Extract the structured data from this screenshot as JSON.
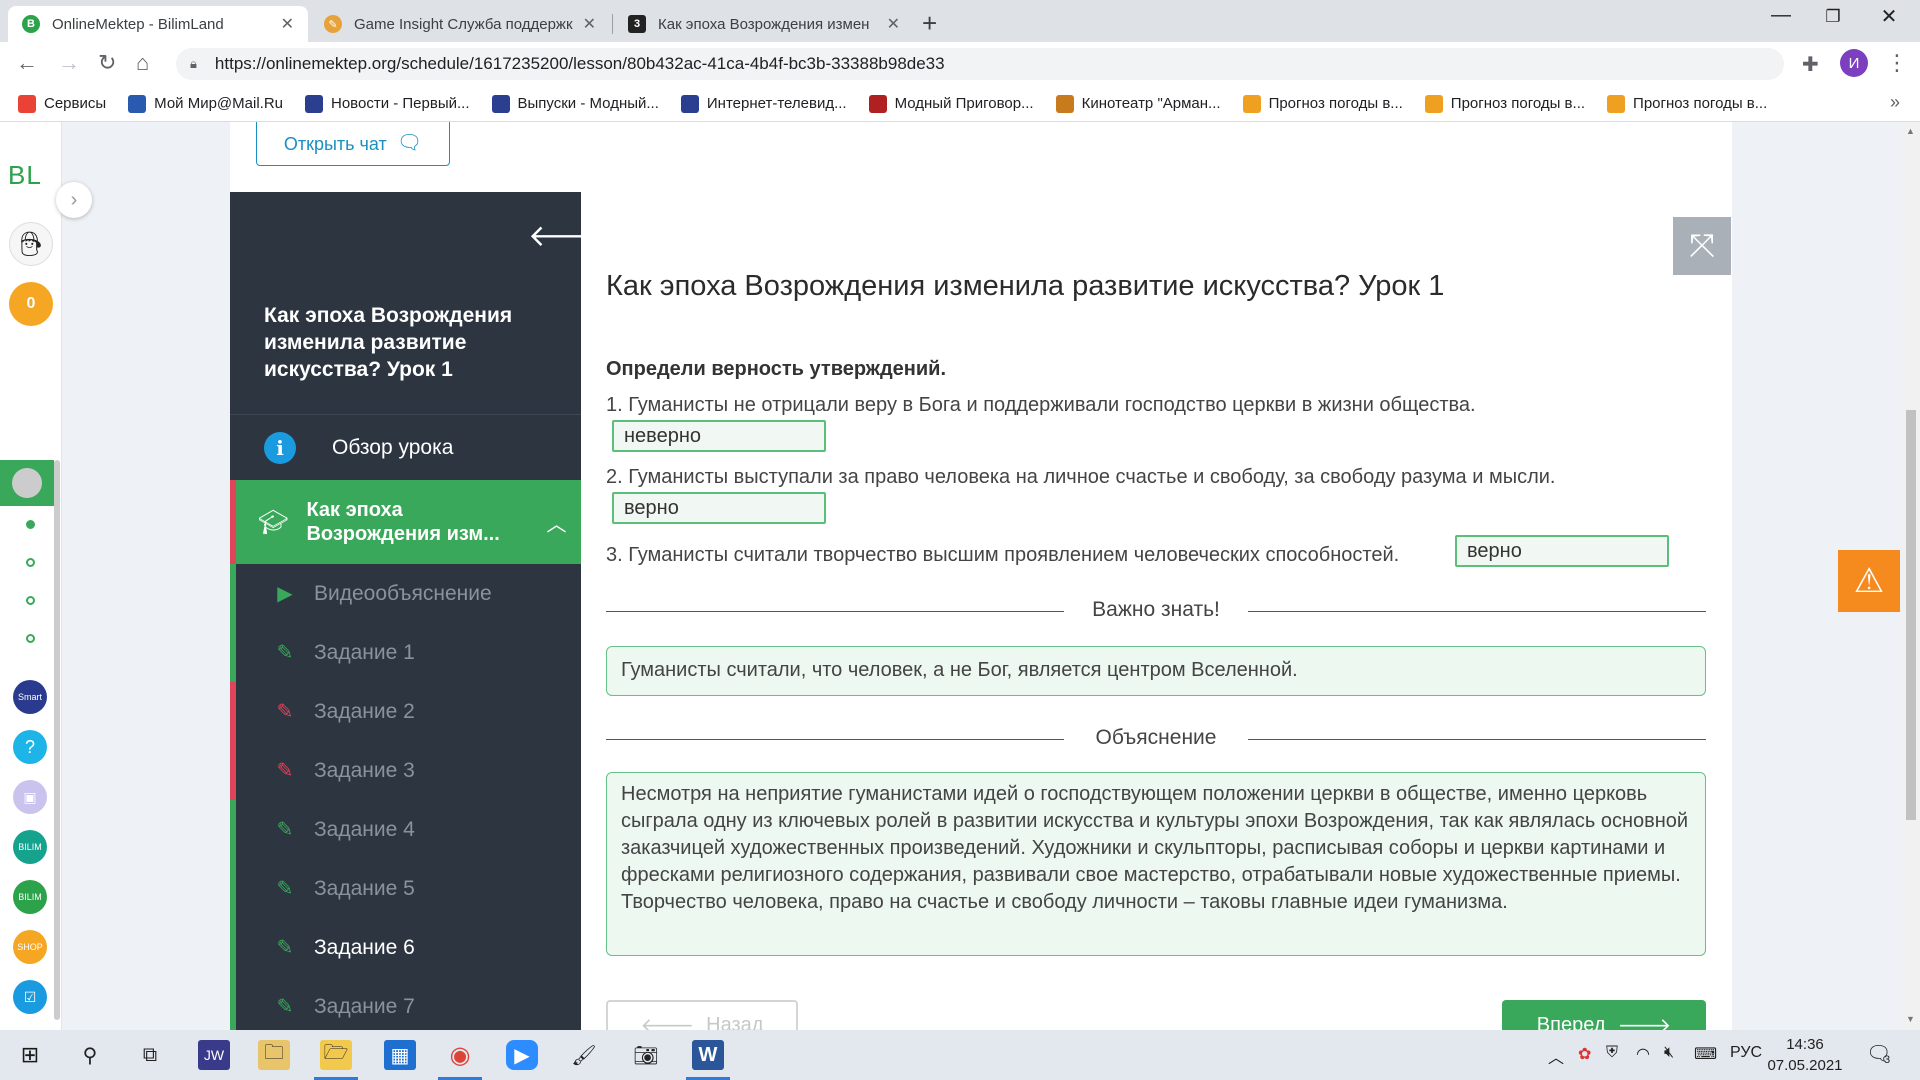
{
  "browser": {
    "tabs": [
      {
        "title": "OnlineMektep - BilimLand",
        "favicon": "B",
        "favicon_color": "#2ca24a",
        "close": "✕"
      },
      {
        "title": "Game Insight Служба поддержк",
        "favicon": "✎",
        "favicon_color": "#e8a23a",
        "close": "✕"
      },
      {
        "title": "Как эпоха Возрождения измен",
        "favicon": "3",
        "favicon_color": "#222222",
        "close": "✕"
      }
    ],
    "new_tab": "+",
    "url": "https://onlinemektep.org/schedule/1617235200/lesson/80b432ac-41ca-4b4f-bc3b-33388b98de33",
    "profile_initial": "И",
    "bookmarks": [
      {
        "label": "Сервисы",
        "color": "#ea4335"
      },
      {
        "label": "Мой Мир@Mail.Ru",
        "color": "#2a5ab0"
      },
      {
        "label": "Новости - Первый...",
        "color": "#2a3f8f"
      },
      {
        "label": "Выпуски - Модный...",
        "color": "#2a3f8f"
      },
      {
        "label": "Интернет-телевид...",
        "color": "#2a3f8f"
      },
      {
        "label": "Модный Приговор...",
        "color": "#b02020"
      },
      {
        "label": "Кинотеатр \"Арман...",
        "color": "#c77b1c"
      },
      {
        "label": "Прогноз погоды в...",
        "color": "#f0a020"
      },
      {
        "label": "Прогноз погоды в...",
        "color": "#f0a020"
      },
      {
        "label": "Прогноз погоды в...",
        "color": "#f0a020"
      }
    ],
    "bookmarks_more": "»"
  },
  "leftbar": {
    "logo": "BL",
    "coins": "0"
  },
  "page": {
    "open_chat_label": "Открыть чат",
    "sidebar": {
      "title": "Как эпоха Возрождения изменила развитие искусства? Урок 1",
      "overview_label": "Обзор урока",
      "lesson_label": "Как эпоха Возрождения изм...",
      "items": [
        {
          "label": "Видеообъяснение",
          "icon": "play-icon",
          "state": "done"
        },
        {
          "label": "Задание 1",
          "icon": "edit-icon",
          "state": "done"
        },
        {
          "label": "Задание 2",
          "icon": "edit-icon",
          "state": "wrong"
        },
        {
          "label": "Задание 3",
          "icon": "edit-icon",
          "state": "wrong"
        },
        {
          "label": "Задание 4",
          "icon": "edit-icon",
          "state": "done"
        },
        {
          "label": "Задание 5",
          "icon": "edit-icon",
          "state": "done"
        },
        {
          "label": "Задание 6",
          "icon": "edit-icon",
          "state": "current"
        },
        {
          "label": "Задание 7",
          "icon": "edit-icon",
          "state": "done"
        }
      ]
    },
    "heading": "Как эпоха Возрождения изменила развитие искусства? Урок 1",
    "instruction": "Определи верность утверждений.",
    "statements": [
      {
        "text": "1. Гуманисты не отрицали веру в Бога и поддерживали господство церкви в жизни общества.",
        "answer": "неверно"
      },
      {
        "text": "2. Гуманисты выступали за право человека на личное счастье и свободу, за свободу разума и мысли.",
        "answer": "верно"
      },
      {
        "text": "3. Гуманисты считали творчество высшим проявлением человеческих способностей.",
        "answer": "верно"
      }
    ],
    "important_title": "Важно знать!",
    "important_text": "Гуманисты считали, что человек, а не Бог, является центром Вселенной.",
    "explanation_title": "Объяснение",
    "explanation_text": "Несмотря на неприятие гуманистами идей о господствующем положении церкви в обществе, именно церковь сыграла одну из ключевых ролей в развитии искусства и культуры эпохи Возрождения, так как являлась основной заказчицей художественных произведений. Художники и скульпторы, расписывая соборы и церкви картинами и фресками религиозного содержания, развивали свое мастерство, отрабатывали новые художественные приемы. Творчество человека, право на счастье и свободу личности – таковы главные идеи гуманизма.",
    "back_label": "Назад",
    "next_label": "Вперед"
  },
  "taskbar": {
    "lang": "РУС",
    "time": "14:36",
    "date": "07.05.2021",
    "notifications": "3"
  },
  "colors": {
    "accent_green": "#3aa85a",
    "error_red": "#e0445a",
    "sidebar_bg": "#2d3541",
    "link_blue": "#1a8fc1",
    "warning_orange": "#f58a1f"
  }
}
